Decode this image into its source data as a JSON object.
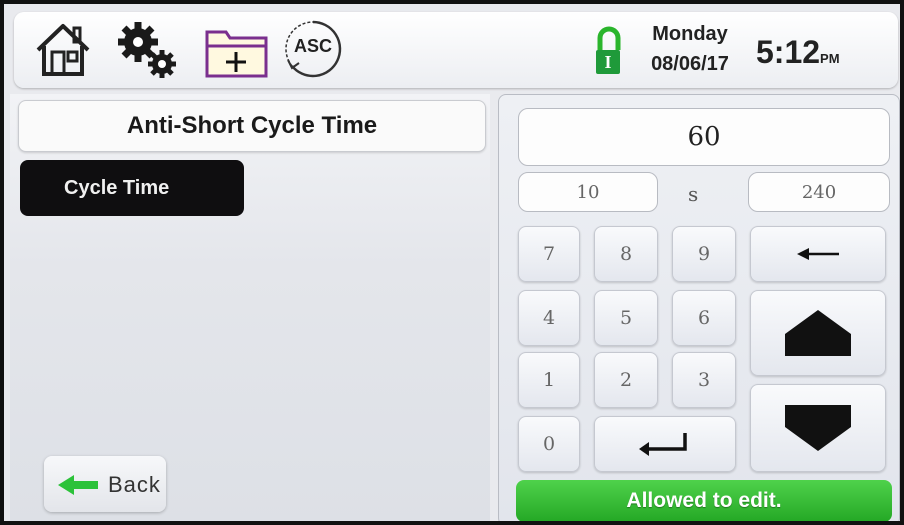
{
  "header": {
    "icons": [
      "home-icon",
      "settings-gears-icon",
      "add-folder-icon",
      "asc-icon"
    ],
    "asc_label": "ASC",
    "lock_label": "I",
    "day": "Monday",
    "date": "08/06/17",
    "time": "5:12",
    "ampm": "PM"
  },
  "panel": {
    "title": "Anti-Short Cycle Time",
    "tabs": [
      {
        "label": "Cycle Time",
        "selected": true
      }
    ],
    "back_label": "Back"
  },
  "keypad": {
    "value": "60",
    "min": "10",
    "unit": "s",
    "max": "240",
    "digits": [
      "7",
      "8",
      "9",
      "4",
      "5",
      "6",
      "1",
      "2",
      "3",
      "0"
    ],
    "status": "Allowed to edit."
  },
  "colors": {
    "status_green": "#2fb52c",
    "lock_green": "#1f9a3a",
    "back_arrow_green": "#2cc23a",
    "folder_purple": "#7a2f8e",
    "dark_tab": "#0f0e10"
  }
}
